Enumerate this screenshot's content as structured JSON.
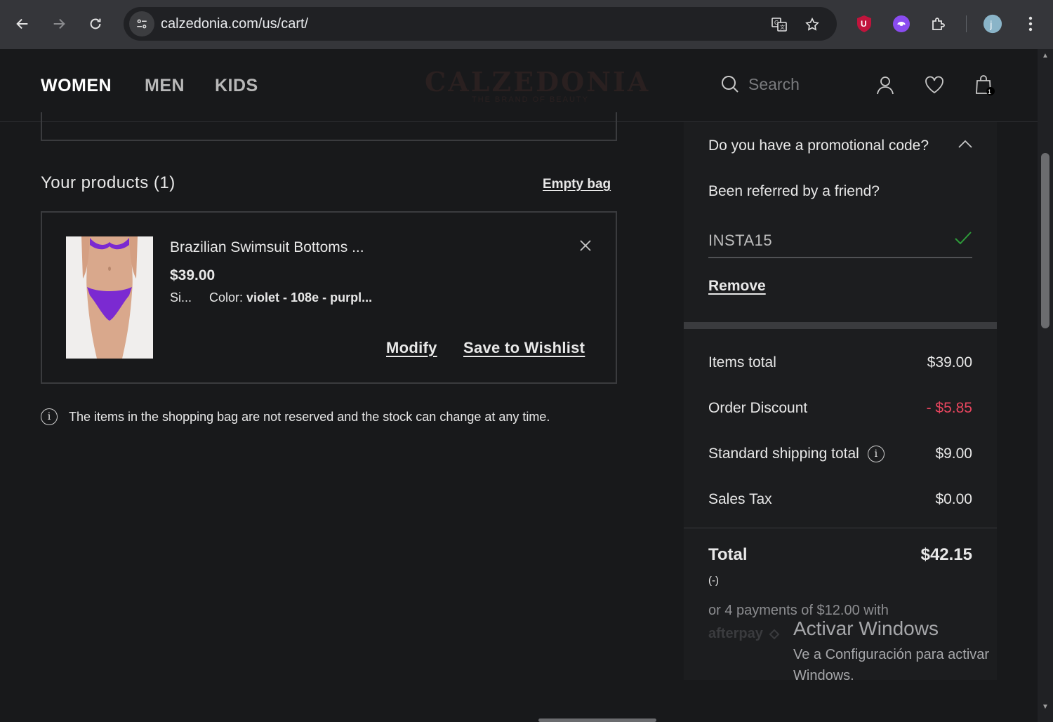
{
  "browser": {
    "url": "calzedonia.com/us/cart/"
  },
  "header": {
    "nav": [
      "WOMEN",
      "MEN",
      "KIDS"
    ],
    "logo": "CALZEDONIA",
    "logo_sub": "THE BRAND OF BEAUTY",
    "search_placeholder": "Search",
    "bag_count": "1"
  },
  "cart": {
    "products_title": "Your products (1)",
    "empty_bag": "Empty bag",
    "product": {
      "name": "Brazilian Swimsuit Bottoms ...",
      "price": "$39.00",
      "size": "Si...",
      "color_label": "Color:",
      "color_value": "violet - 108e - purpl...",
      "modify": "Modify",
      "wishlist": "Save to Wishlist"
    },
    "notice": "The items in the shopping bag are not reserved and the stock can change at any time."
  },
  "promo": {
    "question": "Do you have a promotional code?",
    "referred": "Been referred by a friend?",
    "code": "INSTA15",
    "remove": "Remove"
  },
  "summary": {
    "items_total_label": "Items total",
    "items_total": "$39.00",
    "discount_label": "Order Discount",
    "discount": "- $5.85",
    "shipping_label": "Standard shipping total",
    "shipping": "$9.00",
    "tax_label": "Sales Tax",
    "tax": "$0.00",
    "total_label": "Total",
    "total": "$42.15",
    "total_sub": "(-)",
    "installments": "or 4 payments of $12.00 with",
    "afterpay": "afterpay"
  },
  "watermark": {
    "title": "Activar Windows",
    "line1": "Ve a Configuración para activar",
    "line2": "Windows."
  },
  "colors": {
    "accent_discount": "#e8455e",
    "check": "#2e9d3a",
    "swimsuit": "#7b2ad1"
  }
}
